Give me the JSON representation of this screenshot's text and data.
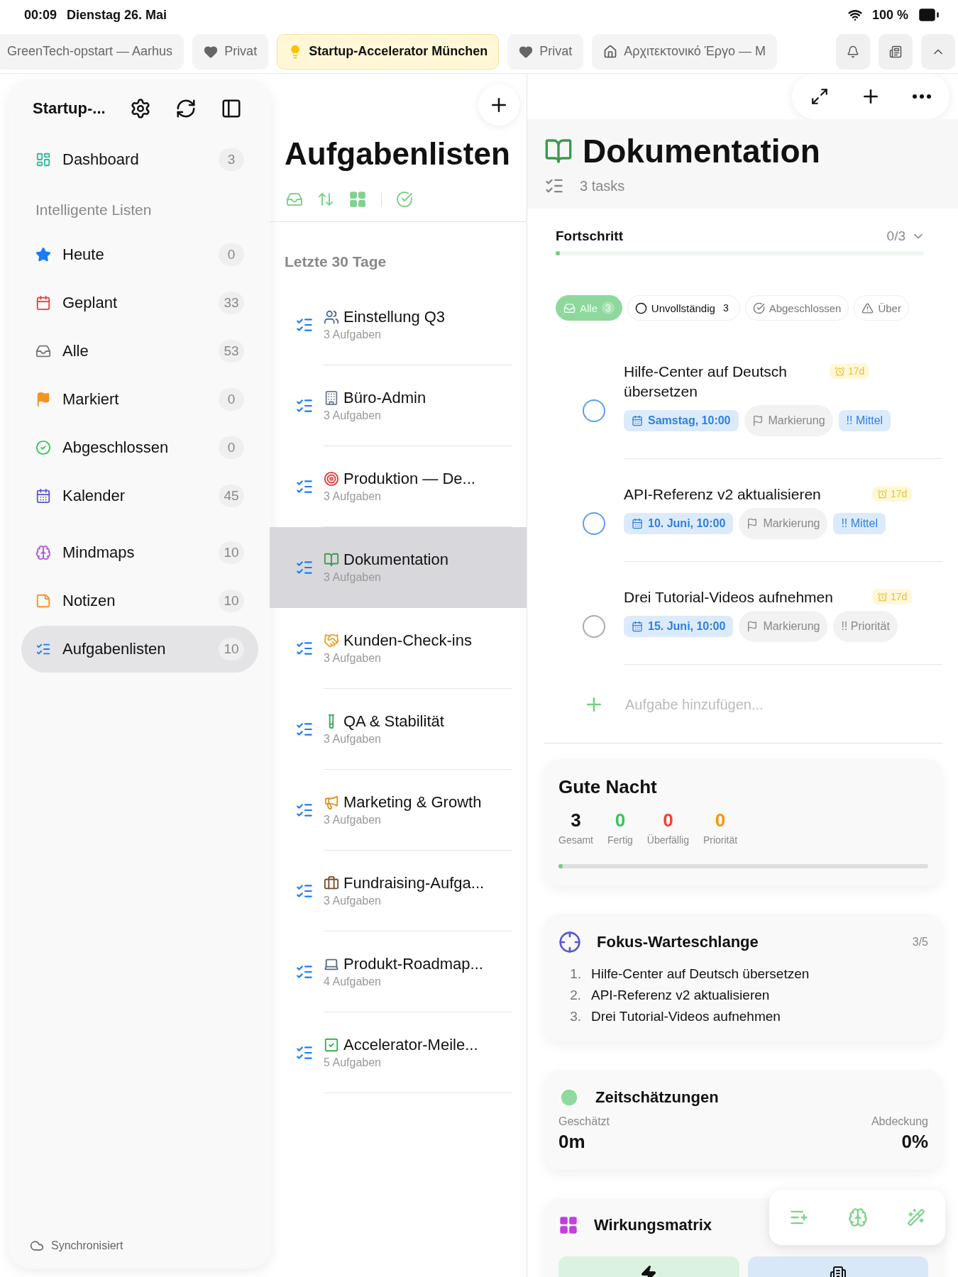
{
  "status_bar": {
    "time": "00:09",
    "date": "Dienstag 26. Mai",
    "battery": "100 %"
  },
  "tabs": [
    {
      "label": "GreenTech-opstart — Aarhus",
      "selected": false
    },
    {
      "label": "Privat",
      "selected": false
    },
    {
      "label": "Startup-Accelerator München",
      "selected": true
    },
    {
      "label": "Privat",
      "selected": false
    },
    {
      "label": "Αρχιτεκτονικό Έργο — Μ",
      "selected": false
    }
  ],
  "sidebar": {
    "title": "Startup-...",
    "top_items": [
      {
        "label": "Dashboard",
        "count": "3",
        "selected": false
      }
    ],
    "section_label": "Intelligente Listen",
    "smart_items": [
      {
        "label": "Heute",
        "count": "0",
        "selected": false
      },
      {
        "label": "Geplant",
        "count": "33",
        "selected": false
      },
      {
        "label": "Alle",
        "count": "53",
        "selected": false
      },
      {
        "label": "Markiert",
        "count": "0",
        "selected": false
      },
      {
        "label": "Abgeschlossen",
        "count": "0",
        "selected": false
      },
      {
        "label": "Kalender",
        "count": "45",
        "selected": false
      }
    ],
    "other_items": [
      {
        "label": "Mindmaps",
        "count": "10",
        "selected": false
      },
      {
        "label": "Notizen",
        "count": "10",
        "selected": false
      },
      {
        "label": "Aufgabenlisten",
        "count": "10",
        "selected": true
      }
    ],
    "footer": "Synchronisiert"
  },
  "lists": {
    "title": "Aufgabenlisten",
    "group": "Letzte 30 Tage",
    "items": [
      {
        "name": "Einstellung Q3",
        "sub": "3 Aufgaben",
        "selected": false
      },
      {
        "name": "Büro-Admin",
        "sub": "3 Aufgaben",
        "selected": false
      },
      {
        "name": "Produktion — De...",
        "sub": "3 Aufgaben",
        "selected": false
      },
      {
        "name": "Dokumentation",
        "sub": "3 Aufgaben",
        "selected": true
      },
      {
        "name": "Kunden-Check-ins",
        "sub": "3 Aufgaben",
        "selected": false
      },
      {
        "name": "QA & Stabilität",
        "sub": "3 Aufgaben",
        "selected": false
      },
      {
        "name": "Marketing & Growth",
        "sub": "3 Aufgaben",
        "selected": false
      },
      {
        "name": "Fundraising-Aufga...",
        "sub": "3 Aufgaben",
        "selected": false
      },
      {
        "name": "Produkt-Roadmap...",
        "sub": "4 Aufgaben",
        "selected": false
      },
      {
        "name": "Accelerator-Meile...",
        "sub": "5 Aufgaben",
        "selected": false
      }
    ]
  },
  "detail": {
    "title": "Dokumentation",
    "subtitle": "3 tasks",
    "progress": {
      "label": "Fortschritt",
      "value": "0/3",
      "level": 0
    },
    "filters": [
      {
        "label": "Alle",
        "count": "3",
        "selected": true
      },
      {
        "label": "Unvollständig",
        "count": "3",
        "selected": false
      },
      {
        "label": "Abgeschlossen",
        "selected": false
      },
      {
        "label": "Über",
        "selected": false
      }
    ],
    "tasks": [
      {
        "title": "Hilfe-Center auf Deutsch übersetzen",
        "checked": false,
        "due": "Samstag, 10:00",
        "flag": "Markierung",
        "priority": "!! Mittel",
        "priority_set": true,
        "age": "17d"
      },
      {
        "title": "API-Referenz v2 aktualisieren",
        "checked": false,
        "due": "10. Juni, 10:00",
        "flag": "Markierung",
        "priority": "!! Mittel",
        "priority_set": true,
        "age": "17d"
      },
      {
        "title": "Drei Tutorial-Videos aufnehmen",
        "checked": false,
        "due": "15. Juni, 10:00",
        "flag": "Markierung",
        "priority": "!! Priorität",
        "priority_set": false,
        "age": "17d"
      }
    ],
    "add_placeholder": "Aufgabe hinzufügen..."
  },
  "summary": {
    "title": "Gute Nacht",
    "level": 0,
    "stats": [
      {
        "value": "3",
        "label": "Gesamt",
        "color": "#111111"
      },
      {
        "value": "0",
        "label": "Fertig",
        "color": "#34c759"
      },
      {
        "value": "0",
        "label": "Überfällig",
        "color": "#ff3b30"
      },
      {
        "value": "0",
        "label": "Priorität",
        "color": "#ff9500"
      }
    ]
  },
  "focus": {
    "title": "Fokus-Warteschlange",
    "count": "3/5",
    "items": [
      {
        "number": "1.",
        "text": "Hilfe-Center auf Deutsch übersetzen"
      },
      {
        "number": "2.",
        "text": "API-Referenz v2 aktualisieren"
      },
      {
        "number": "3.",
        "text": "Drei Tutorial-Videos aufnehmen"
      }
    ]
  },
  "estimates": {
    "title": "Zeitschätzungen",
    "estimated_label": "Geschätzt",
    "estimated": "0m",
    "coverage_label": "Abdeckung",
    "coverage": "0%"
  },
  "matrix": {
    "title": "Wirkungsmatrix",
    "quadrants": [
      {
        "color": "#dcf2e0"
      },
      {
        "color": "#d8e8f8"
      }
    ]
  }
}
